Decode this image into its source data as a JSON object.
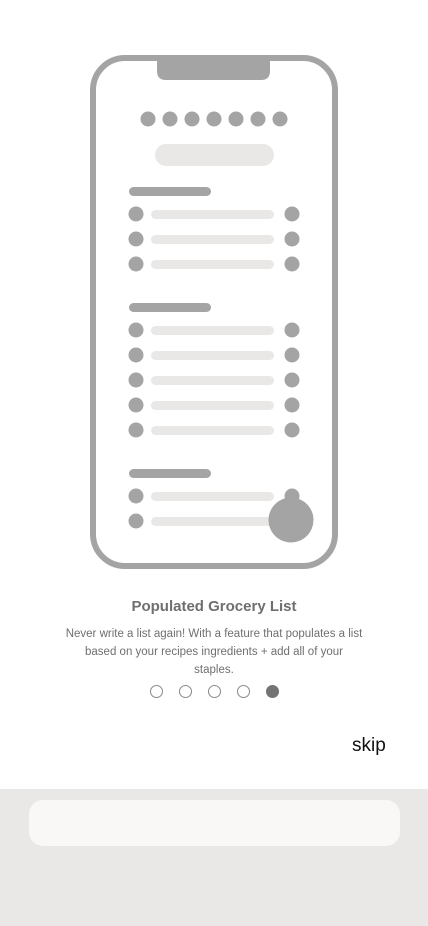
{
  "onboarding": {
    "title": "Populated Grocery List",
    "description": "Never write a list again! With a feature that populates a list based on your recipes ingredients + add all of your staples.",
    "page_count": 5,
    "active_page": 5,
    "skip_label": "skip"
  },
  "illustration": {
    "icon": "phone-grocery-list-illustration",
    "colors": {
      "frame": "#a4a4a4",
      "line": "#e9e8e6",
      "background": "#ffffff"
    },
    "header_dot_count": 7,
    "sections": [
      {
        "rows": 3
      },
      {
        "rows": 5
      },
      {
        "rows": 2
      }
    ]
  },
  "colors": {
    "text": "#6f6f6f",
    "skip_text": "#111111",
    "active_dot": "#747474",
    "bottom_panel": "#e9e8e6"
  }
}
